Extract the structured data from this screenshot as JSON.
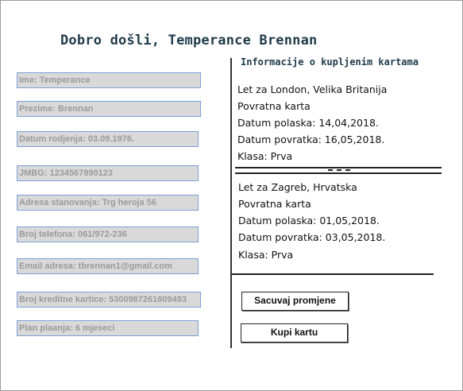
{
  "header": {
    "welcome": "Dobro došli, Temperance Brennan"
  },
  "profile": {
    "fields": [
      "Ime: Temperance",
      "Prezime: Brennan",
      "Datum rodjenja: 03.09.1976.",
      "JMBG: 1234567890123",
      "Adresa stanovanja: Trg heroja 56",
      "Broj telefona: 061/972-236",
      "Email adresa: tbrennan1@gmail.com",
      "Broj kreditne kartice: 5300987261609493",
      "Plan plaanja: 6 mjeseci"
    ]
  },
  "tickets": {
    "title": "Informacije o kupljenim kartama",
    "separator": "----",
    "items": [
      {
        "flight": "Let za London, Velika Britanija",
        "type": "Povratna karta",
        "departure": "Datum polaska: 14,04,2018.",
        "return": "Datum povratka: 16,05,2018.",
        "class": "Klasa: Prva"
      },
      {
        "flight": "Let za Zagreb, Hrvatska",
        "type": "Povratna karta",
        "departure": "Datum polaska: 01,05,2018.",
        "return": "Datum povratka: 03,05,2018.",
        "class": "Klasa: Prva"
      }
    ]
  },
  "actions": {
    "save_label": "Sacuvaj promjene",
    "buy_label": "Kupi kartu"
  }
}
